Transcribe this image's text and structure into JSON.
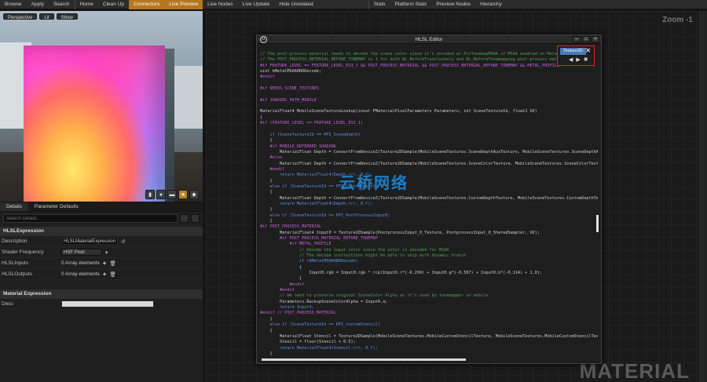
{
  "toolbar": {
    "items": [
      "Browse",
      "Apply",
      "Search",
      "Home",
      "Clean Up",
      "Connectors",
      "Live Preview",
      "Live Nodes",
      "Live Update",
      "Hide Unrelated",
      "Stats",
      "Platform Stats",
      "Preview Nodes",
      "Hierarchy"
    ]
  },
  "viewport": {
    "buttons": [
      "Perspective",
      "Lit",
      "Show"
    ]
  },
  "details": {
    "tabs": [
      "Details",
      "Parameter Defaults"
    ],
    "search_placeholder": "Search Details",
    "category1": "HLSLExpression",
    "rows": [
      {
        "label": "Description",
        "value": "HLSLMaterialExpression"
      },
      {
        "label": "Shader Frequency",
        "value": "HSF Pixel"
      },
      {
        "label": "HLSLInputs",
        "value": "0 Array elements"
      },
      {
        "label": "HLSLOutputs",
        "value": "0 Array elements"
      }
    ],
    "category2": "Material Expression",
    "desc_label": "Desc"
  },
  "graph": {
    "zoom": "Zoom -1",
    "watermark": "MATERIAL"
  },
  "editor": {
    "title": "HLSL Editor",
    "texture_label": "Texture2D",
    "code": [
      "// The post-process material needs to decode the scene color since it's encoded at PixTonemapMSAA if MSAA enabled on MetalMobilePlatform",
      "// The POST_PROCESS_MATERIAL_BEFORE_TONEMAP is 1 for both BL_BeforeTranslucency and BL_BeforeTonemapping post-process materials",
      "#if FEATURE_LEVEL == FEATURE_LEVEL_ES3_1 && POST_PROCESS_MATERIAL && POST_PROCESS_MATERIAL_BEFORE_TONEMAP && METAL_PROFILE",
      "uint bMetalMSAAHDRDecode;",
      "#endif",
      "",
      "#if NEEDS_SCENE_TEXTURES",
      "",
      "#if SHADING_PATH_MOBILE",
      "",
      "MaterialFloat4 MobileSceneTextureLookup(inout FMaterialPixelParameters Parameters, int SceneTextureId, float2 UV)",
      "{",
      "#if (FEATURE_LEVEL == FEATURE_LEVEL_ES3_1)",
      "",
      "    if (SceneTextureId == PPI_SceneDepth)",
      "    {",
      "    #if MOBILE_DEFERRED_SHADING",
      "        MaterialFloat Depth = ConvertFromDeviceZ(Texture2DSample(MobileSceneTextures.SceneDepthAuxTexture, MobileSceneTextures.SceneDepthAuxTexture",
      "    #else",
      "        MaterialFloat Depth = ConvertFromDeviceZ(Texture2DSample(MobileSceneTextures.SceneColorTexture, MobileSceneTextures.SceneColorTextureSampler",
      "    #endif",
      "        return MaterialFloat4(Depth.rrr, 0.f);",
      "    }",
      "    else if (SceneTextureId == PPI_CustomDepth)",
      "    {",
      "        MaterialFloat Depth = ConvertFromDeviceZ(Texture2DSample(MobileSceneTextures.CustomDepthTexture, MobileSceneTextures.CustomDepthTextureSamp",
      "        return MaterialFloat4(Depth.rrr, 0.f);",
      "    }",
      "    else if (SceneTextureId == PPI_PostProcessInput0)",
      "    {",
      "#if POST_PROCESS_MATERIAL",
      "        MaterialFloat4 Input0 = Texture2DSample(PostprocessInput_0_Texture, PostprocessInput_0_SharedSampler, UV);",
      "        #if POST_PROCESS_MATERIAL_BEFORE_TONEMAP",
      "            #if METAL_PROFILE",
      "                // Decode the input color since the color is encoded for MSAA",
      "                // The decode instructions might be able to skip with dynamic branch",
      "                if (bMetalMSAAHDRDecode)",
      "                {",
      "                    Input0.rgb = Input0.rgb * rcp(Input0.r*(-0.299) + Input0.g*(-0.587) + Input0.b*(-0.114) + 1.0);",
      "                }",
      "            #endif",
      "        #endif",
      "        // We need to preserve original SceneColor Alpha as it's used by tonemapper on mobile",
      "        Parameters.BackupSceneColorAlpha = Input0.a;",
      "        return Input0;",
      "#endif // POST_PROCESS_MATERIAL",
      "    }",
      "    else if (SceneTextureId == PPI_CustomStencil)",
      "    {",
      "        MaterialFloat Stencil = Texture2DSample(MobileSceneTextures.MobileCustomStencilTexture, MobileSceneTextures.MobileCustomStencilTextureSampler, U",
      "        Stencil = floor(Stencil + 0.5);",
      "        return MaterialFloat4(Stencil.rrr, 0.f);",
      "    }"
    ]
  },
  "site_watermark": "云桥网络",
  "colors": {
    "accent_orange": "#b5761f",
    "highlight_red": "#e02020",
    "texture_blue": "#4a7ab8"
  }
}
